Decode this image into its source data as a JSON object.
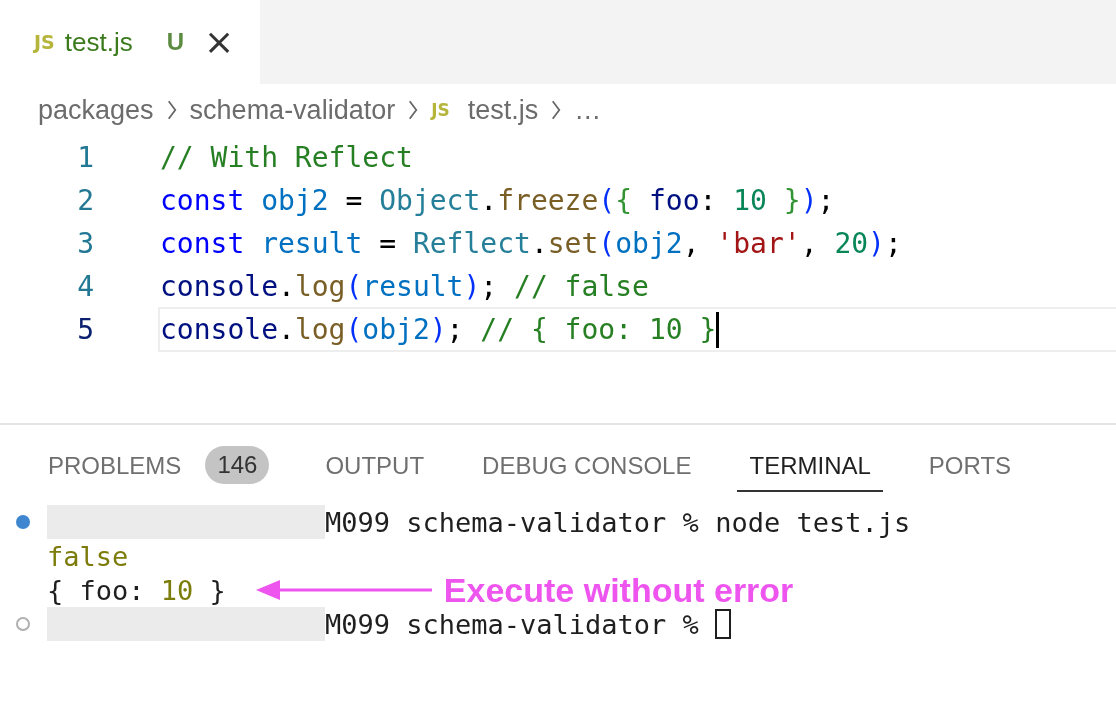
{
  "tabs": [
    {
      "icon": "JS",
      "label": "test.js",
      "badge": "U",
      "close": "×",
      "selected": true
    }
  ],
  "breadcrumbs": [
    {
      "label": "packages"
    },
    {
      "label": "schema-validator"
    },
    {
      "label": "test.js",
      "icon": "JS"
    },
    {
      "label": "…"
    }
  ],
  "code_lines": [
    {
      "number": "1",
      "current": false,
      "tokens": [
        {
          "text": "// With Reflect",
          "kind": "comment"
        }
      ]
    },
    {
      "number": "2",
      "current": false,
      "tokens": [
        {
          "text": "const ",
          "kind": "keyword"
        },
        {
          "text": "obj2",
          "kind": "variable"
        },
        {
          "text": " = ",
          "kind": "plain"
        },
        {
          "text": "Object",
          "kind": "class"
        },
        {
          "text": ".",
          "kind": "plain"
        },
        {
          "text": "freeze",
          "kind": "function"
        },
        {
          "text": "(",
          "kind": "bracket"
        },
        {
          "text": "{ ",
          "kind": "brace"
        },
        {
          "text": "foo",
          "kind": "property"
        },
        {
          "text": ": ",
          "kind": "plain"
        },
        {
          "text": "10 ",
          "kind": "number"
        },
        {
          "text": "}",
          "kind": "brace"
        },
        {
          "text": ")",
          "kind": "bracket"
        },
        {
          "text": ";",
          "kind": "plain"
        }
      ]
    },
    {
      "number": "3",
      "current": false,
      "tokens": [
        {
          "text": "const ",
          "kind": "keyword"
        },
        {
          "text": "result",
          "kind": "variable"
        },
        {
          "text": " = ",
          "kind": "plain"
        },
        {
          "text": "Reflect",
          "kind": "class"
        },
        {
          "text": ".",
          "kind": "plain"
        },
        {
          "text": "set",
          "kind": "function"
        },
        {
          "text": "(",
          "kind": "bracket"
        },
        {
          "text": "obj2",
          "kind": "variable"
        },
        {
          "text": ", ",
          "kind": "plain"
        },
        {
          "text": "'bar'",
          "kind": "string"
        },
        {
          "text": ", ",
          "kind": "plain"
        },
        {
          "text": "20",
          "kind": "number"
        },
        {
          "text": ")",
          "kind": "bracket"
        },
        {
          "text": ";",
          "kind": "plain"
        }
      ]
    },
    {
      "number": "4",
      "current": false,
      "tokens": [
        {
          "text": "console",
          "kind": "property"
        },
        {
          "text": ".",
          "kind": "plain"
        },
        {
          "text": "log",
          "kind": "function"
        },
        {
          "text": "(",
          "kind": "bracket"
        },
        {
          "text": "result",
          "kind": "variable"
        },
        {
          "text": ")",
          "kind": "bracket"
        },
        {
          "text": "; ",
          "kind": "plain"
        },
        {
          "text": "// false",
          "kind": "comment"
        }
      ]
    },
    {
      "number": "5",
      "current": true,
      "tokens": [
        {
          "text": "console",
          "kind": "property"
        },
        {
          "text": ".",
          "kind": "plain"
        },
        {
          "text": "log",
          "kind": "function"
        },
        {
          "text": "(",
          "kind": "bracket"
        },
        {
          "text": "obj2",
          "kind": "variable"
        },
        {
          "text": ")",
          "kind": "bracket"
        },
        {
          "text": "; ",
          "kind": "plain"
        },
        {
          "text": "// { foo: 10 }",
          "kind": "comment"
        }
      ]
    }
  ],
  "panel_tabs": [
    {
      "label": "PROBLEMS",
      "count": "146",
      "selected": false
    },
    {
      "label": "OUTPUT",
      "selected": false
    },
    {
      "label": "DEBUG CONSOLE",
      "selected": false
    },
    {
      "label": "TERMINAL",
      "selected": true
    },
    {
      "label": "PORTS",
      "selected": false
    }
  ],
  "terminal_lines": [
    {
      "kind": "prompt",
      "succeeded": true,
      "redacted": true,
      "text": "M099 schema-validator % node test.js"
    },
    {
      "kind": "output",
      "tokens": [
        {
          "text": "false",
          "kind": "value"
        }
      ]
    },
    {
      "kind": "output",
      "tokens": [
        {
          "text": "{ foo: ",
          "kind": "plain"
        },
        {
          "text": "10",
          "kind": "value"
        },
        {
          "text": " }",
          "kind": "plain"
        }
      ],
      "annotation": "Execute without error"
    },
    {
      "kind": "prompt",
      "succeeded": false,
      "redacted": true,
      "text": "M099 schema-validator %",
      "cursor": true
    }
  ]
}
